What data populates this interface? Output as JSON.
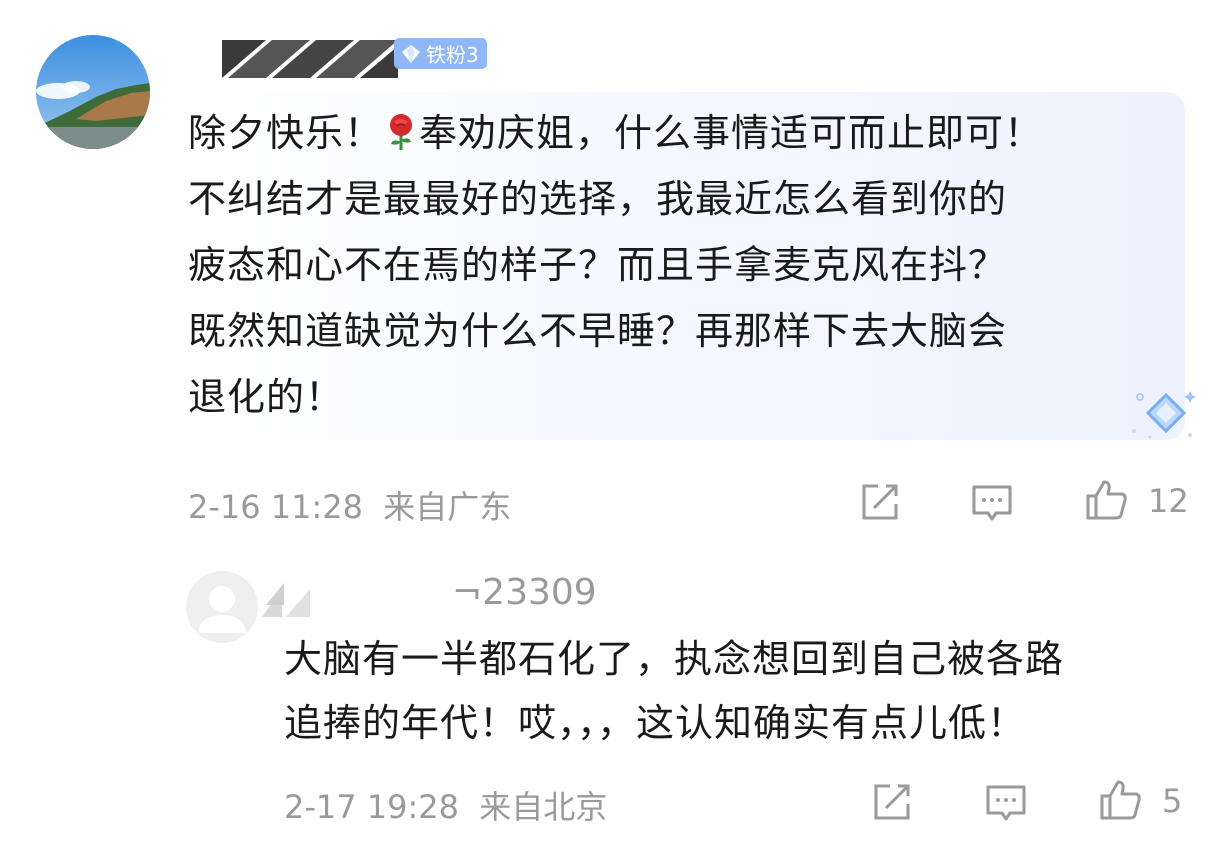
{
  "comment": {
    "badge_label": "铁粉3",
    "text_lines": [
      "除夕快乐！🌹奉劝庆姐，什么事情适可而止即可！",
      "不纠结才是最最好的选择，我最近怎么看到你的",
      "疲态和心不在焉的样子？而且手拿麦克风在抖？",
      "既然知道缺觉为什么不早睡？再那样下去大脑会",
      "退化的！"
    ],
    "line1_before_emoji": "除夕快乐！",
    "line1_after_emoji": "奉劝庆姐，什么事情适可而止即可！",
    "timestamp": "2-16 11:28",
    "location": "来自广东",
    "like_count": "12"
  },
  "reply": {
    "username_visible": "¬23309",
    "text_lines": [
      "大脑有一半都石化了，执念想回到自己被各路",
      "追捧的年代！哎，，，这认知确实有点儿低！"
    ],
    "timestamp": "2-17 19:28",
    "location": "来自北京",
    "like_count": "5"
  },
  "colors": {
    "badge_bg": "#8fb7f5",
    "meta_text": "#9a9a9a",
    "bubble_tint": "#eef2fe"
  },
  "icons": [
    "share-icon",
    "comment-icon",
    "thumbs-up-icon",
    "rose-emoji-icon",
    "diamond-icon"
  ]
}
